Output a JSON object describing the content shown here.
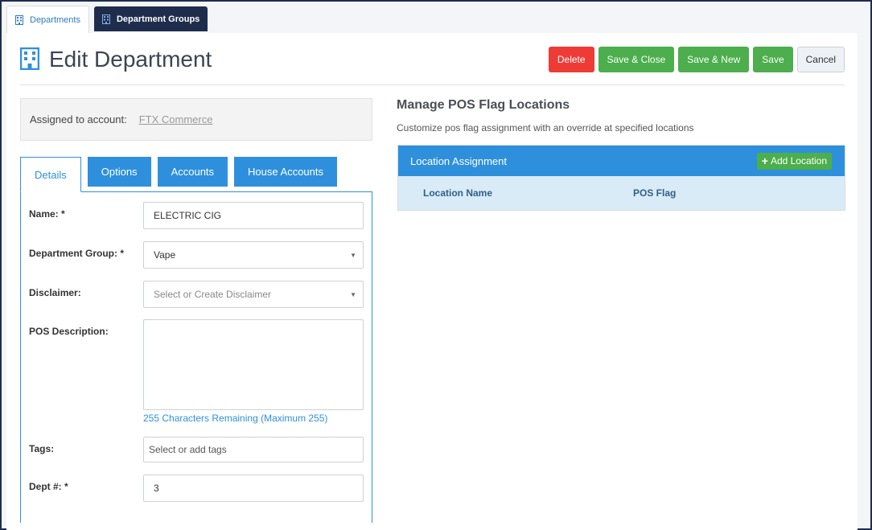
{
  "top_tabs": [
    {
      "label": "Departments",
      "icon": "building-icon",
      "active": true
    },
    {
      "label": "Department Groups",
      "icon": "building-icon",
      "active": false
    }
  ],
  "page": {
    "title": "Edit Department",
    "icon": "building-icon"
  },
  "toolbar": {
    "delete_label": "Delete",
    "save_close_label": "Save & Close",
    "save_new_label": "Save & New",
    "save_label": "Save",
    "cancel_label": "Cancel"
  },
  "account": {
    "label": "Assigned to account:",
    "value": "FTX Commerce"
  },
  "form_tabs": [
    {
      "label": "Details",
      "active": true
    },
    {
      "label": "Options",
      "active": false
    },
    {
      "label": "Accounts",
      "active": false
    },
    {
      "label": "House Accounts",
      "active": false
    }
  ],
  "form": {
    "name_label": "Name: *",
    "name_value": "ELECTRIC CIG",
    "group_label": "Department Group: *",
    "group_value": "Vape",
    "disclaimer_label": "Disclaimer:",
    "disclaimer_placeholder": "Select or Create Disclaimer",
    "pos_desc_label": "POS Description:",
    "pos_desc_value": "",
    "chars_remaining": "255 Characters Remaining (Maximum 255)",
    "tags_label": "Tags:",
    "tags_placeholder": "Select or add tags",
    "dept_label": "Dept #: *",
    "dept_value": "3"
  },
  "pos_flags": {
    "title": "Manage POS Flag Locations",
    "subtitle": "Customize pos flag assignment with an override at specified locations",
    "table_title": "Location Assignment",
    "add_label": "Add Location",
    "columns": [
      "Location Name",
      "POS Flag"
    ]
  },
  "colors": {
    "primary": "#2e90dc",
    "danger": "#ef3b36",
    "success": "#4cae4c",
    "navy": "#1f2d4d"
  }
}
